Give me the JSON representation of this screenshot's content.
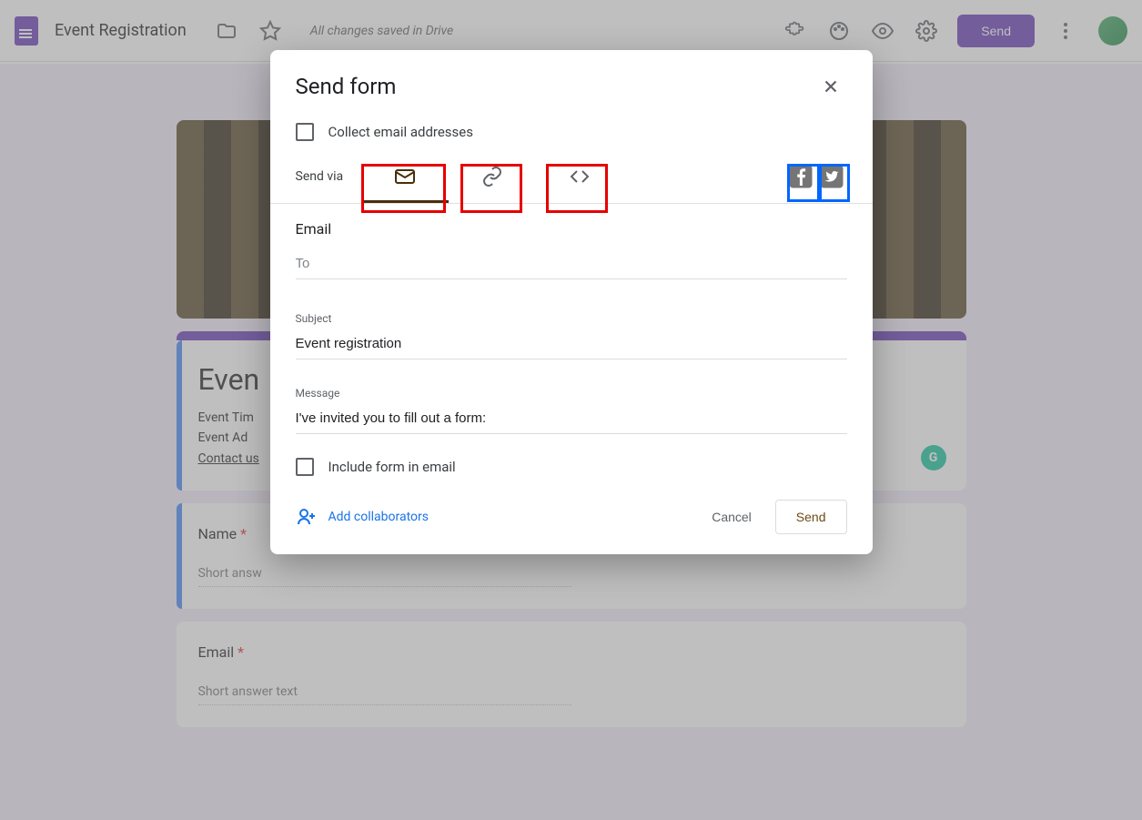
{
  "toolbar": {
    "title": "Event Registration",
    "saved_text": "All changes saved in Drive",
    "send_label": "Send"
  },
  "form": {
    "heading": "Even",
    "desc_line1": "Event Tim",
    "desc_line2": "Event Ad",
    "desc_line3": "Contact us",
    "q1_label": "Name",
    "q2_label": "Email",
    "short_answer": "Short answer text",
    "short_answer_partial": "Short answ",
    "required_mark": "*",
    "grammarly": "G"
  },
  "modal": {
    "title": "Send form",
    "collect_label": "Collect email addresses",
    "sendvia_label": "Send via",
    "section_title": "Email",
    "to_label": "To",
    "subject_label": "Subject",
    "subject_value": "Event registration",
    "message_label": "Message",
    "message_value": "I've invited you to fill out a form:",
    "include_label": "Include form in email",
    "add_collab": "Add collaborators",
    "cancel": "Cancel",
    "send": "Send"
  }
}
